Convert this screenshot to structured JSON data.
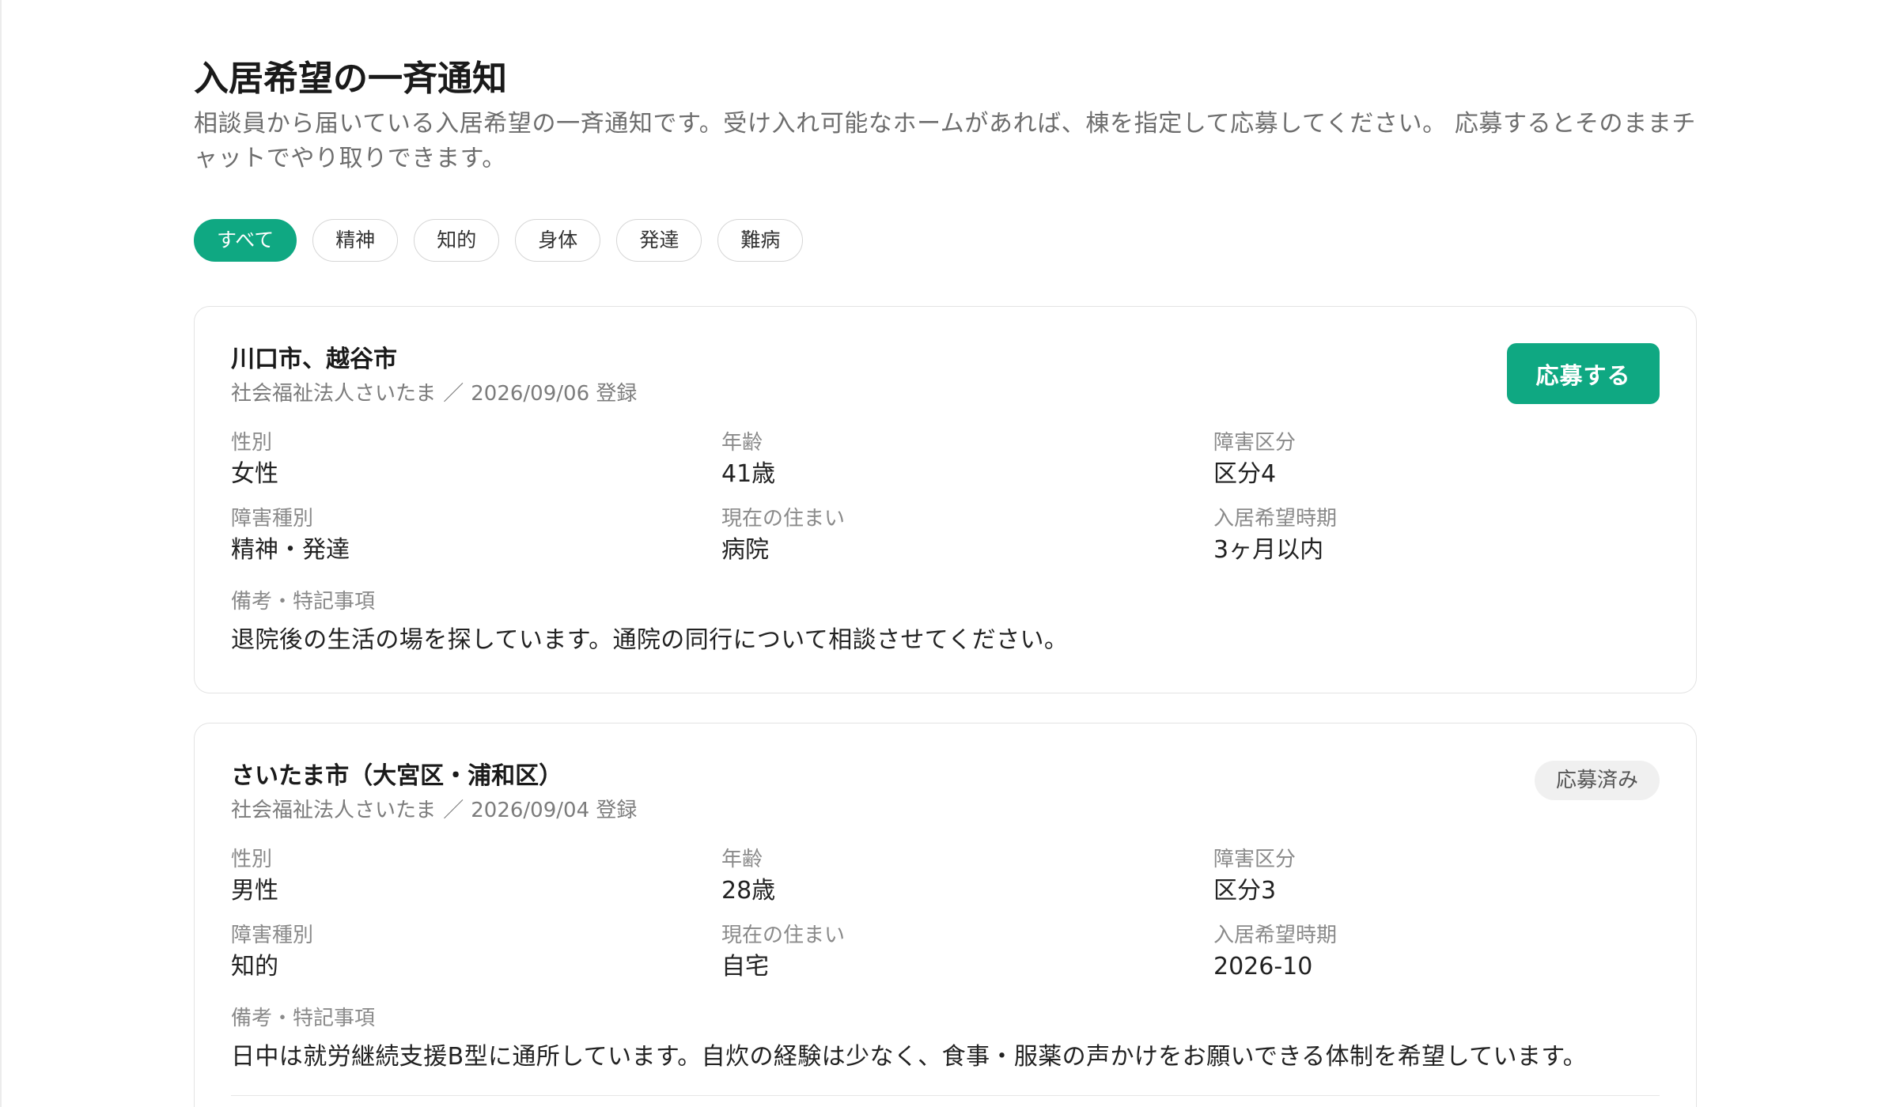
{
  "page": {
    "title": "入居希望の一斉通知",
    "description": "相談員から届いている入居希望の一斉通知です。受け入れ可能なホームがあれば、棟を指定して応募してください。 応募するとそのままチャットでやり取りできます。"
  },
  "filters": [
    {
      "label": "すべて",
      "active": true
    },
    {
      "label": "精神",
      "active": false
    },
    {
      "label": "知的",
      "active": false
    },
    {
      "label": "身体",
      "active": false
    },
    {
      "label": "発達",
      "active": false
    },
    {
      "label": "難病",
      "active": false
    }
  ],
  "field_labels": {
    "gender": "性別",
    "age": "年齢",
    "support_level": "障害区分",
    "disability_type": "障害種別",
    "current_residence": "現在の住まい",
    "desired_move_in": "入居希望時期",
    "notes": "備考・特記事項"
  },
  "meta_separator": "／",
  "cards": [
    {
      "area": "川口市、越谷市",
      "organization": "社会福祉法人さいたま",
      "registered": "2026/09/06 登録",
      "apply_button_label": "応募する",
      "gender": "女性",
      "age": "41歳",
      "support_level": "区分4",
      "disability_type": "精神・発達",
      "current_residence": "病院",
      "desired_move_in": "3ヶ月以内",
      "notes": "退院後の生活の場を探しています。通院の同行について相談させてください。"
    },
    {
      "area": "さいたま市（大宮区・浦和区）",
      "organization": "社会福祉法人さいたま",
      "registered": "2026/09/04 登録",
      "status_badge": "応募済み",
      "gender": "男性",
      "age": "28歳",
      "support_level": "区分3",
      "disability_type": "知的",
      "current_residence": "自宅",
      "desired_move_in": "2026-10",
      "notes": "日中は就労継続支援B型に通所しています。自炊の経験は少なく、食事・服薬の声かけをお願いできる体制を希望しています。"
    }
  ],
  "colors": {
    "accent": "#0fa882"
  }
}
